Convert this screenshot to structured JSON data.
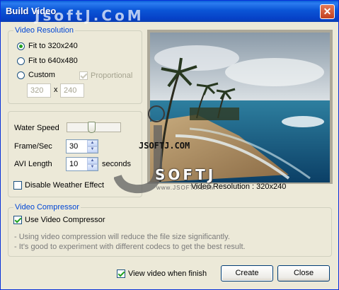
{
  "window": {
    "title": "Build Video",
    "watermark": "JsoftJ.CoM",
    "close_glyph": "✕"
  },
  "resolution": {
    "legend": "Video Resolution",
    "opt_320": "Fit to 320x240",
    "opt_640": "Fit to 640x480",
    "opt_custom": "Custom",
    "proportional": "Proportional",
    "width": "320",
    "height": "240",
    "x_sep": "x",
    "selected": "opt_320"
  },
  "settings": {
    "water_speed_label": "Water Speed",
    "water_speed_level": 0.45,
    "framesec_label": "Frame/Sec",
    "framesec_value": "30",
    "avi_label": "AVI Length",
    "avi_value": "10",
    "avi_unit": "seconds",
    "disable_weather": "Disable Weather Effect"
  },
  "preview": {
    "resolution_text": "Video Resolution :  320x240",
    "watermark_site": "JSOFTJ.COM",
    "watermark_brand": "SOFTJ",
    "watermark_small": "www.JSOFTJ.COM"
  },
  "compressor": {
    "legend": "Video Compressor",
    "use_label": "Use Video Compressor",
    "note1": "- Using video compression will reduce the file size significantly.",
    "note2": "- It's good to experiment with different codecs to get the best result."
  },
  "footer": {
    "view_label": "View video when finish",
    "create": "Create",
    "close": "Close"
  },
  "colors": {
    "accent": "#0046d5",
    "check": "#21a121",
    "title_bar": "#0a5fd8"
  }
}
